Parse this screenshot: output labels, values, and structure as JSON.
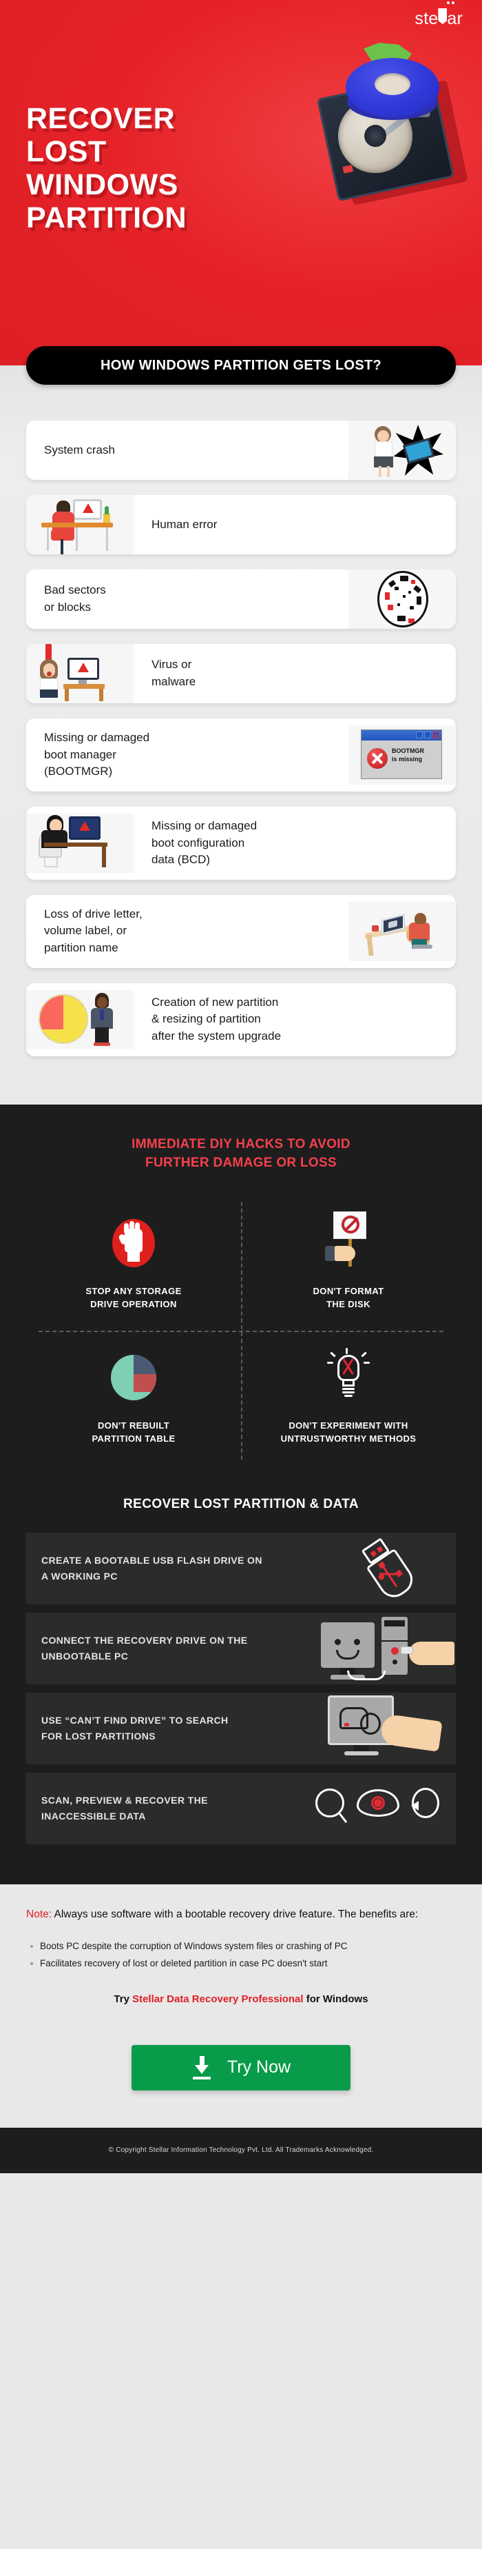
{
  "brand": {
    "logo_text": "stellar",
    "accent_red": "#e52228",
    "dark": "#1d1d1d",
    "green": "#089b4a"
  },
  "hero": {
    "line1": "RECOVER",
    "line2": "LOST",
    "line3": "WINDOWS",
    "line4": "PARTITION"
  },
  "banner": {
    "title": "HOW WINDOWS PARTITION GETS LOST?"
  },
  "causes": [
    {
      "text": "System crash",
      "art": "woman-smashing-laptop-illustration",
      "art_side": "right"
    },
    {
      "text": "Human error",
      "art": "man-at-desk-error-illustration",
      "art_side": "left"
    },
    {
      "text": "Bad sectors\nor blocks",
      "art": "disk-platter-bad-sectors-icon",
      "art_side": "right"
    },
    {
      "text": "Virus or\nmalware",
      "art": "woman-screaming-at-monitor-illustration",
      "art_side": "left"
    },
    {
      "text": "Missing or damaged\nboot manager\n(BOOTMGR)",
      "art": "bootmgr-error-dialog",
      "art_side": "right"
    },
    {
      "text": "Missing or damaged\nboot configuration\ndata (BCD)",
      "art": "man-at-monitor-warning-illustration",
      "art_side": "left"
    },
    {
      "text": "Loss of drive letter,\nvolume label, or\npartition name",
      "art": "isometric-desk-laptop-illustration",
      "art_side": "right"
    },
    {
      "text": "Creation of new partition\n& resizing of partition\nafter the system upgrade",
      "art": "pie-chart-businessman-illustration",
      "art_side": "left"
    }
  ],
  "bootmgr_dialog": {
    "line1": "BOOTMGR",
    "line2": "is missing"
  },
  "diy": {
    "title_line1": "IMMEDIATE DIY HACKS TO AVOID",
    "title_line2": "FURTHER DAMAGE OR LOSS",
    "items": [
      {
        "caption": "STOP ANY STORAGE\nDRIVE OPERATION",
        "icon": "stop-hand-icon"
      },
      {
        "caption": "DON'T FORMAT\nTHE DISK",
        "icon": "no-format-sign-icon"
      },
      {
        "caption": "DON'T REBUILT\nPARTITION TABLE",
        "icon": "pie-chart-icon"
      },
      {
        "caption": "DON'T EXPERIMENT WITH\nUNTRUSTWORTHY METHODS",
        "icon": "crossed-bulb-icon"
      }
    ]
  },
  "recover": {
    "title": "RECOVER LOST PARTITION & DATA",
    "steps": [
      {
        "text": "CREATE A BOOTABLE USB FLASH DRIVE ON\nA WORKING PC",
        "icon": "usb-flash-drive-icon"
      },
      {
        "text": "CONNECT THE RECOVERY DRIVE ON THE\nUNBOOTABLE PC",
        "icon": "desktop-pc-usb-hand-icon"
      },
      {
        "text": "USE “CAN’T FIND DRIVE” TO SEARCH\nFOR LOST PARTITIONS",
        "icon": "monitor-magnifier-hand-icon"
      },
      {
        "text": "SCAN, PREVIEW & RECOVER THE\nINACCESSIBLE DATA",
        "icon": "scan-preview-recover-icons"
      }
    ]
  },
  "note": {
    "label": "Note:",
    "body": " Always use software with a bootable recovery drive feature. The benefits are:",
    "bullets": [
      "Boots PC despite the corruption of Windows system files or crashing of PC",
      "Facilitates recovery of lost or deleted partition in case PC doesn't start"
    ],
    "cta_prefix": "Try ",
    "cta_product": "Stellar Data Recovery Professional",
    "cta_suffix": " for Windows"
  },
  "cta_button": {
    "label": "Try Now",
    "icon": "download-icon"
  },
  "footer": {
    "copyright": "© Copyright Stellar Information Technology Pvt. Ltd. All Trademarks Acknowledged."
  }
}
